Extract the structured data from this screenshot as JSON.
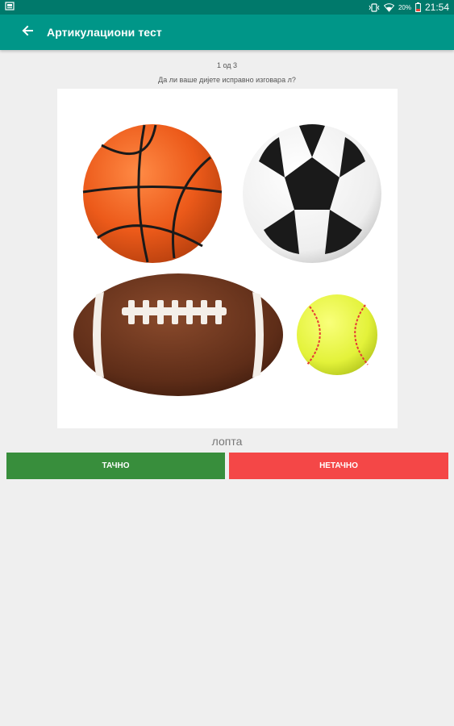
{
  "status_bar": {
    "battery_percent": "20%",
    "time": "21:54",
    "icons": [
      "screenshot-icon",
      "vibrate-icon",
      "wifi-icon",
      "battery-icon"
    ]
  },
  "app_bar": {
    "title": "Артикулациони тест",
    "back_icon": "arrow-left-icon"
  },
  "progress": "1 од 3",
  "question": "Да ли ваше дијете исправно изговара л?",
  "image": {
    "description_icons": [
      "basketball",
      "soccer-ball",
      "american-football",
      "softball"
    ]
  },
  "word": "лопта",
  "buttons": {
    "correct_label": "ТАЧНО",
    "incorrect_label": "НЕТАЧНО"
  },
  "colors": {
    "status_bar": "#00796b",
    "app_bar": "#009688",
    "correct": "#388e3c",
    "incorrect": "#f44747",
    "background": "#efefef"
  }
}
